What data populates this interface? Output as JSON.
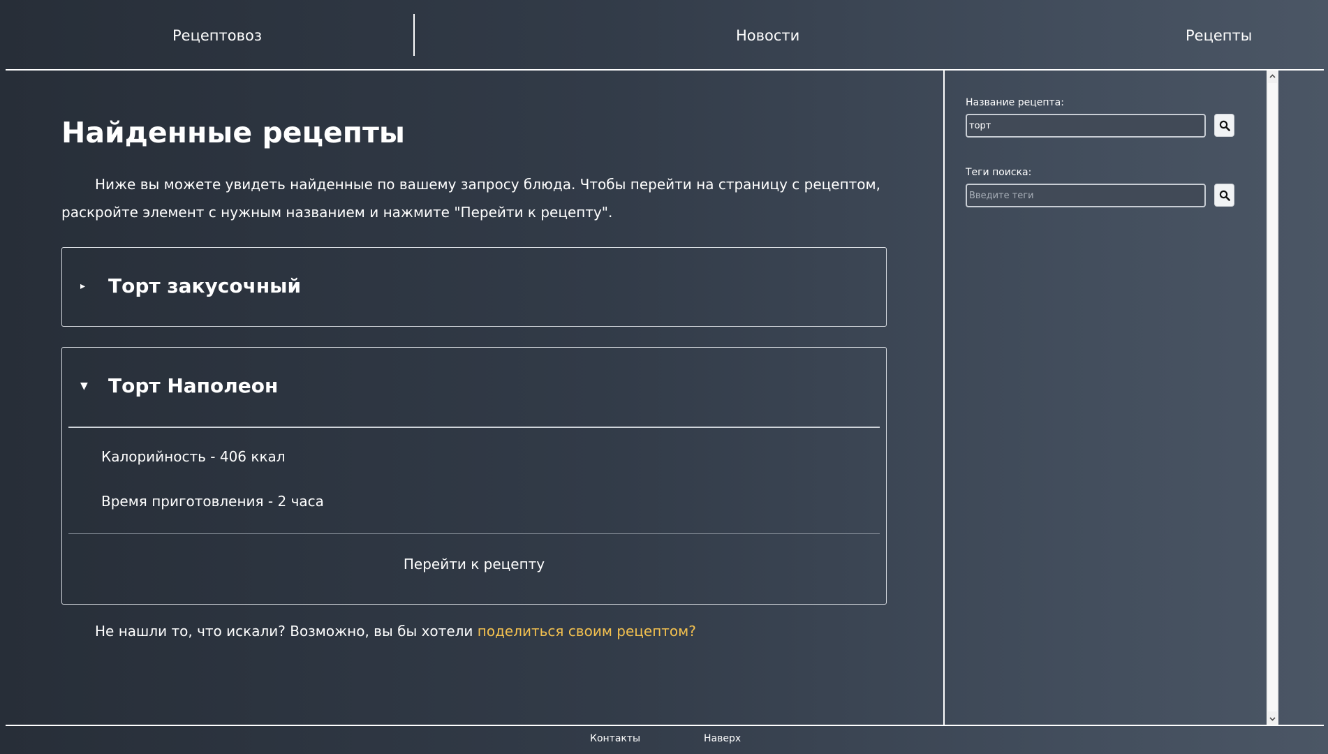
{
  "header": {
    "brand": "Рецептовоз",
    "nav_news": "Новости",
    "nav_recipes": "Рецепты"
  },
  "main": {
    "title": "Найденные рецепты",
    "intro": "Ниже вы можете увидеть найденные по вашему запросу блюда. Чтобы перейти на страницу с рецептом, раскройте элемент с нужным названием и нажмите \"Перейти к рецепту\".",
    "recipes": [
      {
        "name": "Торт закусочный",
        "expanded": false,
        "arrow": "▸"
      },
      {
        "name": "Торт Наполеон",
        "expanded": true,
        "arrow": "▼",
        "calories": "Калорийность - 406 ккал",
        "time": "Время приготовления - 2 часа",
        "goto_label": "Перейти к рецепту"
      }
    ],
    "not_found_text": "Не нашли то, что искали? Возможно, вы бы хотели ",
    "share_link": "поделиться своим рецептом?"
  },
  "sidebar": {
    "name_label": "Название рецепта:",
    "name_value": "торт",
    "tags_label": "Теги поиска:",
    "tags_value": "",
    "tags_placeholder": "Введите теги"
  },
  "footer": {
    "contacts": "Контакты",
    "to_top": "Наверх"
  },
  "colors": {
    "accent_link": "#f4c14f",
    "background_start": "#272e38",
    "background_end": "#4b5665"
  }
}
